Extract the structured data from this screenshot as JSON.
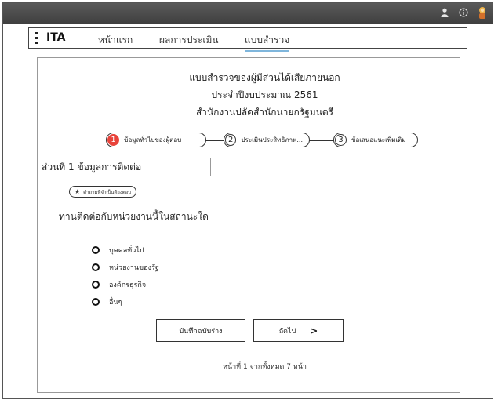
{
  "topbar": {
    "icons": [
      "user-icon",
      "info-icon",
      "avatar-icon"
    ]
  },
  "nav": {
    "brand": "ITA",
    "items": [
      {
        "label": "หน้าแรก"
      },
      {
        "label": "ผลการประเมิน"
      },
      {
        "label": "แบบสำรวจ",
        "active": true
      }
    ]
  },
  "header": {
    "title": "แบบสำรวจของผู้มีส่วนได้เสียภายนอก",
    "subtitle": "ประจำปีงบประมาณ 2561",
    "agency": "สำนักงานปลัดสำนักนายกรัฐมนตรี"
  },
  "stepper": {
    "steps": [
      {
        "number": "1",
        "label": "ข้อมูลทั่วไปของผู้ตอบ",
        "active": true
      },
      {
        "number": "2",
        "label": "ประเมินประสิทธิภาพ...",
        "active": false
      },
      {
        "number": "3",
        "label": "ข้อเสนอแนะเพิ่มเติม",
        "active": false
      }
    ],
    "active_color": "#e8433a"
  },
  "section": {
    "title": "ส่วนที่ 1 ข้อมูลการติดต่อ"
  },
  "required_note": "คำถามที่จำเป็นต้องตอบ",
  "question": {
    "text": "ท่านติดต่อกับหน่วยงานนี้ในสถานะใด",
    "options": [
      {
        "label": "บุคคลทั่วไป"
      },
      {
        "label": "หน่วยงานของรัฐ"
      },
      {
        "label": "องค์กรธุรกิจ"
      },
      {
        "label": "อื่นๆ"
      }
    ]
  },
  "buttons": {
    "save_draft": "บันทึกฉบับร่าง",
    "next": "ถัดไป"
  },
  "pagination": {
    "text": "หน้าที่ 1 จากทั้งหมด 7 หน้า"
  }
}
